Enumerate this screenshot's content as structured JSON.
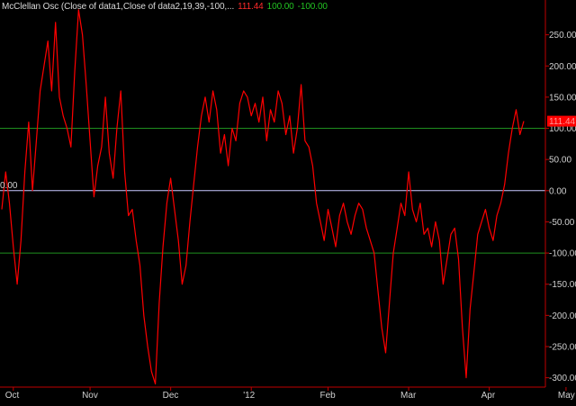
{
  "legend": {
    "name": "McClellan Osc (Close of data1,Close of data2,19,39,-100,...",
    "current_value": "111.44",
    "upper_level": "100.00",
    "lower_level": "-100.00"
  },
  "colors": {
    "background": "#000000",
    "series": "#ff0000",
    "level_line": "#1f8f1f",
    "zero_line": "#c8c8ff",
    "axis": "#c00000"
  },
  "chart_data": {
    "type": "line",
    "title": "",
    "xlabel": "",
    "ylabel": "",
    "ylim": [
      -315,
      300
    ],
    "yticks": [
      "250.00",
      "200.00",
      "150.00",
      "100.00",
      "50.00",
      "0.00",
      "-50.00",
      "-100.00",
      "-150.00",
      "-200.00",
      "-250.00",
      "-300.00"
    ],
    "ytick_values": [
      250,
      200,
      150,
      100,
      50,
      0,
      -50,
      -100,
      -150,
      -200,
      -250,
      -300
    ],
    "xticks": [
      "Oct",
      "Nov",
      "Dec",
      "'12",
      "Feb",
      "Mar",
      "Apr",
      "May"
    ],
    "xtick_index": [
      3,
      23,
      44,
      65,
      85,
      106,
      127,
      147
    ],
    "zero_label": "0.00",
    "levels": [
      100,
      -100
    ],
    "zero_line": 0,
    "last_value_label": "111.44",
    "series": [
      {
        "values": [
          -30,
          30,
          -20,
          -90,
          -150,
          -80,
          30,
          110,
          0,
          80,
          160,
          200,
          240,
          160,
          270,
          150,
          120,
          100,
          70,
          190,
          290,
          250,
          170,
          80,
          -10,
          40,
          70,
          150,
          60,
          20,
          100,
          160,
          30,
          -40,
          -30,
          -80,
          -120,
          -200,
          -250,
          -290,
          -310,
          -180,
          -90,
          -20,
          20,
          -30,
          -80,
          -150,
          -120,
          -50,
          10,
          70,
          120,
          150,
          110,
          160,
          130,
          60,
          90,
          40,
          100,
          80,
          140,
          160,
          150,
          120,
          140,
          110,
          150,
          80,
          130,
          110,
          160,
          140,
          90,
          120,
          60,
          100,
          170,
          80,
          70,
          40,
          -20,
          -50,
          -80,
          -30,
          -60,
          -90,
          -40,
          -20,
          -50,
          -70,
          -40,
          -20,
          -30,
          -60,
          -80,
          -100,
          -160,
          -220,
          -260,
          -180,
          -100,
          -60,
          -20,
          -40,
          30,
          -30,
          -50,
          -20,
          -70,
          -60,
          -90,
          -50,
          -80,
          -150,
          -110,
          -70,
          -60,
          -110,
          -220,
          -300,
          -190,
          -130,
          -70,
          -50,
          -30,
          -60,
          -80,
          -40,
          -20,
          10,
          60,
          100,
          130,
          90,
          111.44
        ]
      }
    ]
  }
}
